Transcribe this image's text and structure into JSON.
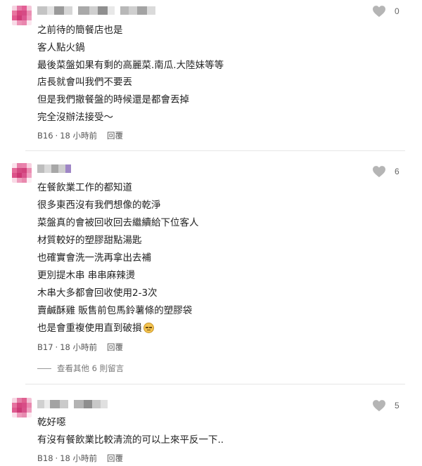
{
  "comments": [
    {
      "lines": [
        "之前待的簡餐店也是",
        "客人點火鍋",
        "最後菜盤如果有剩的高麗菜.南瓜.大陸妹等等",
        "店長就會叫我們不要丟",
        "但是我們撤餐盤的時候還是都會丟掉",
        "完全沒辦法接受～"
      ],
      "floor": "B16",
      "time": "18 小時前",
      "reply_label": "回覆",
      "likes": "0"
    },
    {
      "lines": [
        "在餐飲業工作的都知道",
        "很多東西沒有我們想像的乾淨",
        "菜盤真的會被回收回去繼續給下位客人",
        "材質較好的塑膠甜點湯匙",
        "也確實會洗一洗再拿出去補",
        "更別提木串 串串麻辣燙",
        "木串大多都會回收使用2-3次",
        "賣鹹酥雞 販售前包馬鈴薯條的塑膠袋",
        "也是會重複使用直到破損"
      ],
      "floor": "B17",
      "time": "18 小時前",
      "reply_label": "回覆",
      "likes": "6",
      "more_replies": "查看其他 6 則留言"
    },
    {
      "lines": [
        "乾好噁",
        "有沒有餐飲業比較清流的可以上來平反一下.."
      ],
      "floor": "B18",
      "time": "18 小時前",
      "reply_label": "回覆",
      "likes": "5"
    }
  ],
  "icons": {
    "like": "heart-icon",
    "emoji": "grimace-emoji-icon"
  },
  "colors": {
    "heart": "#b5b5b5",
    "avatar_pink": "#e0649a",
    "text": "#222222",
    "meta": "#555555",
    "divider": "#e6e6e6"
  }
}
